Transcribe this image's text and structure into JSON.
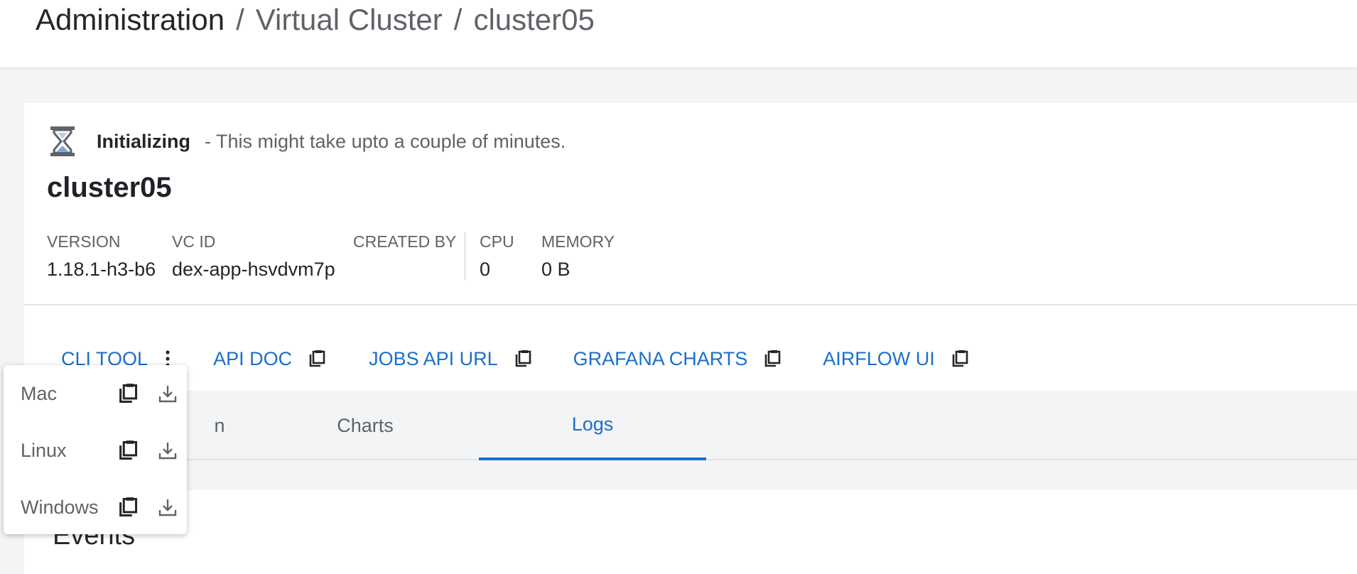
{
  "breadcrumb": {
    "root": "Administration",
    "section": "Virtual Cluster",
    "current": "cluster05",
    "separator": "/"
  },
  "status": {
    "icon": "hourglass-icon",
    "state": "Initializing",
    "message": "- This might take upto a couple of minutes."
  },
  "cluster": {
    "name": "cluster05",
    "meta": [
      {
        "label": "VERSION",
        "value": "1.18.1-h3-b6"
      },
      {
        "label": "VC ID",
        "value": "dex-app-hsvdvm7p"
      },
      {
        "label": "CREATED BY",
        "value": ""
      },
      {
        "label": "CPU",
        "value": "0"
      },
      {
        "label": "MEMORY",
        "value": "0 B"
      }
    ]
  },
  "links": {
    "cli_tool": "CLI TOOL",
    "api_doc": "API DOC",
    "jobs_api_url": "JOBS API URL",
    "grafana_charts": "GRAFANA CHARTS",
    "airflow_ui": "AIRFLOW UI"
  },
  "tabs": {
    "first_partial": "n",
    "charts": "Charts",
    "logs": "Logs",
    "active": "Logs"
  },
  "events": {
    "heading": "Events"
  },
  "cli_menu": {
    "items": [
      {
        "os": "Mac"
      },
      {
        "os": "Linux"
      },
      {
        "os": "Windows"
      }
    ]
  },
  "colors": {
    "accent": "#1a6fcc",
    "background": "#f3f4f6",
    "text": "#232629",
    "muted": "#5f6368"
  }
}
